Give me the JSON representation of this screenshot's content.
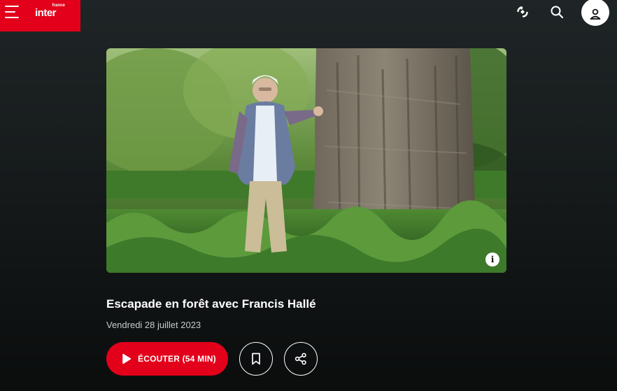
{
  "header": {
    "menu_icon": "hamburger-icon",
    "logo": {
      "small": "france",
      "main": "inter"
    },
    "brand_color": "#e2001a",
    "actions": [
      {
        "name": "live-radio-button",
        "icon": "live-waves-icon"
      },
      {
        "name": "search-button",
        "icon": "search-icon"
      },
      {
        "name": "account-button",
        "icon": "user-icon"
      }
    ]
  },
  "episode": {
    "image_icon": "info-icon",
    "title": "Escapade en forêt avec Francis Hallé",
    "date": "Vendredi 28 juillet 2023",
    "listen_label": "ÉCOUTER (54 MIN)",
    "listen_icon": "play-icon",
    "bookmark_icon": "bookmark-icon",
    "share_icon": "share-icon"
  }
}
